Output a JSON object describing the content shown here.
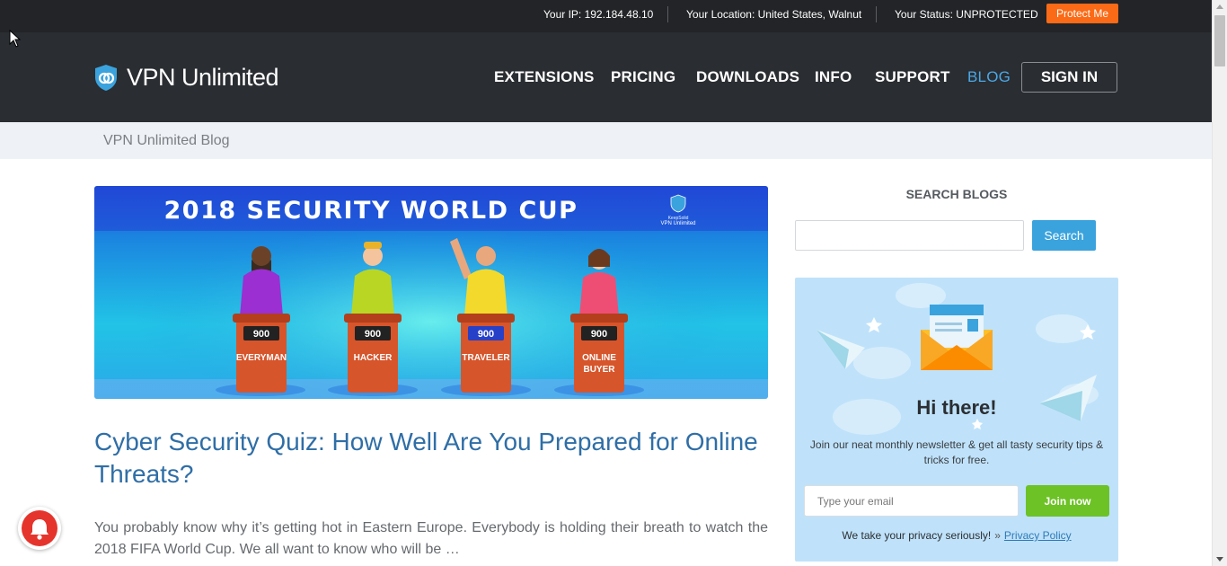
{
  "topbar": {
    "ip": "Your IP: 192.184.48.10",
    "location": "Your Location: United States, Walnut",
    "status": "Your Status: UNPROTECTED",
    "protect_button": "Protect Me"
  },
  "header": {
    "logo_text": "VPN Unlimited",
    "nav": [
      "EXTENSIONS",
      "PRICING",
      "DOWNLOADS",
      "INFO",
      "SUPPORT",
      "BLOG"
    ],
    "active_nav": "BLOG",
    "signin": "SIGN IN"
  },
  "breadcrumb": "VPN Unlimited Blog",
  "post": {
    "hero": {
      "banner_title": "2018 SECURITY WORLD CUP",
      "brand_small": "KeepSolid",
      "brand_name": "VPN Unlimited",
      "contestants": [
        {
          "score": "900",
          "label": "EVERYMAN"
        },
        {
          "score": "900",
          "label": "HACKER"
        },
        {
          "score": "900",
          "label": "TRAVELER"
        },
        {
          "score": "900",
          "label_line1": "ONLINE",
          "label_line2": "BUYER"
        }
      ]
    },
    "title": "Cyber Security Quiz: How Well Are You Prepared for Online Threats?",
    "excerpt": "You probably know why it’s getting hot in Eastern Europe. Everybody is holding their breath to watch the 2018 FIFA World Cup. We all want to know who will be …"
  },
  "sidebar": {
    "search_title": "SEARCH BLOGS",
    "search_value": "",
    "search_button": "Search",
    "newsletter": {
      "title": "Hi there!",
      "text": "Join our neat monthly newsletter & get all tasty security tips & tricks for free.",
      "email_placeholder": "Type your email",
      "join_button": "Join now",
      "privacy_text": "We take your privacy seriously!",
      "privacy_link": "Privacy Policy"
    }
  },
  "colors": {
    "topbar_bg": "#222427",
    "header_bg": "#2a2d31",
    "accent_orange": "#fb6a16",
    "accent_blue": "#3aa3dd",
    "active_nav": "#4aa8e8",
    "title_blue": "#2f6ea6",
    "join_green": "#6dc226",
    "newsletter_bg": "#bfe2fa"
  }
}
